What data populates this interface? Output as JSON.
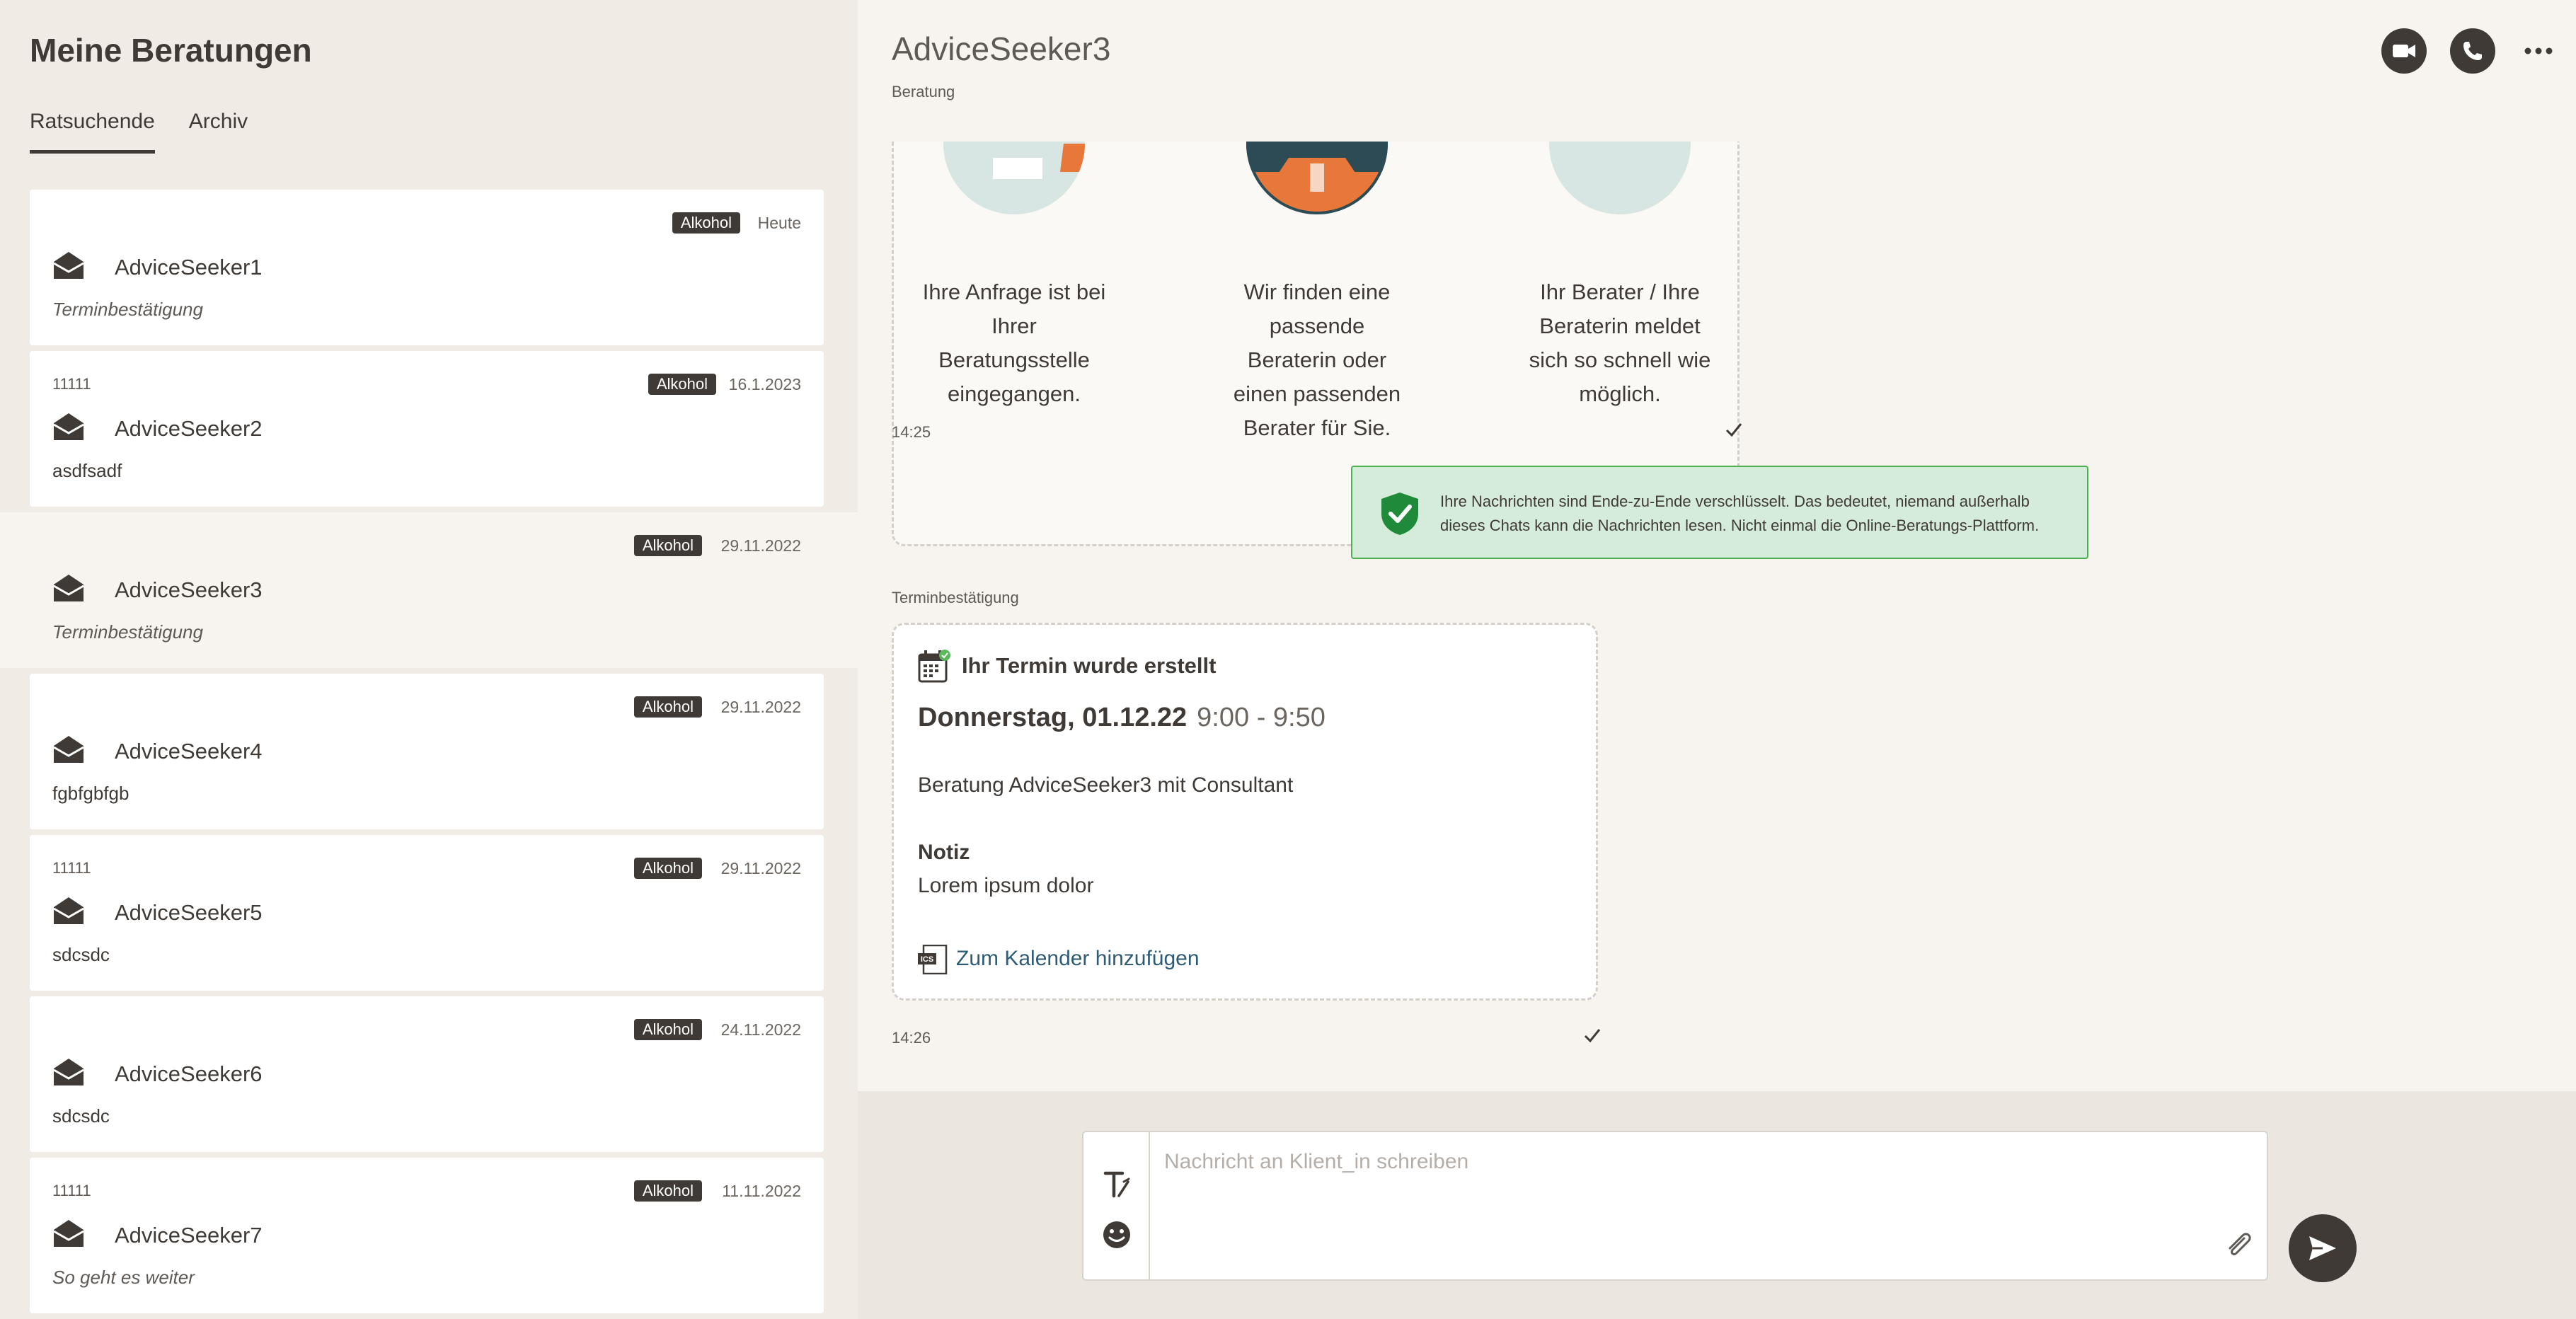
{
  "sidebar": {
    "title": "Meine Beratungen",
    "tabs": [
      {
        "label": "Ratsuchende",
        "active": true
      },
      {
        "label": "Archiv",
        "active": false
      }
    ],
    "sessions": [
      {
        "postcode": "",
        "topic": "Alkohol",
        "date": "Heute",
        "name": "AdviceSeeker1",
        "preview": "Terminbestätigung",
        "preview_italic": true,
        "selected": false
      },
      {
        "postcode": "11111",
        "topic": "Alkohol",
        "date": "16.1.2023",
        "name": "AdviceSeeker2",
        "preview": "asdfsadf",
        "preview_italic": false,
        "selected": false
      },
      {
        "postcode": "",
        "topic": "Alkohol",
        "date": "29.11.2022",
        "name": "AdviceSeeker3",
        "preview": "Terminbestätigung",
        "preview_italic": true,
        "selected": true
      },
      {
        "postcode": "",
        "topic": "Alkohol",
        "date": "29.11.2022",
        "name": "AdviceSeeker4",
        "preview": "fgbfgbfgb",
        "preview_italic": false,
        "selected": false
      },
      {
        "postcode": "11111",
        "topic": "Alkohol",
        "date": "29.11.2022",
        "name": "AdviceSeeker5",
        "preview": "sdcsdc",
        "preview_italic": false,
        "selected": false
      },
      {
        "postcode": "",
        "topic": "Alkohol",
        "date": "24.11.2022",
        "name": "AdviceSeeker6",
        "preview": "sdcsdc",
        "preview_italic": false,
        "selected": false
      },
      {
        "postcode": "11111",
        "topic": "Alkohol",
        "date": "11.11.2022",
        "name": "AdviceSeeker7",
        "preview": "So geht es weiter",
        "preview_italic": true,
        "selected": false
      }
    ]
  },
  "header": {
    "name": "AdviceSeeker3",
    "subtitle": "Beratung",
    "icons": [
      "video-call-icon",
      "phone-icon",
      "more-icon"
    ]
  },
  "welcome": {
    "steps": [
      "Ihre Anfrage ist bei Ihrer Beratungsstelle eingegangen.",
      "Wir finden eine passende Beraterin oder einen passenden Berater für Sie.",
      "Ihr Berater / Ihre Beraterin meldet sich so schnell wie möglich."
    ],
    "time": "14:25"
  },
  "e2e_notice": "Ihre Nachrichten sind Ende-zu-Ende verschlüsselt. Das bedeutet, niemand außerhalb dieses Chats kann die Nachrichten lesen. Nicht einmal die Online-Beratungs-Plattform.",
  "appointment": {
    "label": "Terminbestätigung",
    "heading": "Ihr Termin wurde erstellt",
    "date": "Donnerstag, 01.12.22",
    "time": "9:00 - 9:50",
    "title": "Beratung AdviceSeeker3 mit Consultant",
    "note_label": "Notiz",
    "note": "Lorem ipsum dolor",
    "calendar_link": "Zum Kalender hinzufügen",
    "ics_label": "ICS",
    "sent_time": "14:26"
  },
  "composer": {
    "placeholder": "Nachricht an Klient_in schreiben",
    "icons": [
      "text-format-icon",
      "emoji-icon",
      "attachment-icon",
      "send-icon"
    ]
  },
  "colors": {
    "dark": "#3f3a36",
    "sidebar_bg": "#f0ebe5",
    "main_bg": "#f7f4f0",
    "notice_bg": "#d6ecdb",
    "notice_border": "#4caf50",
    "link": "#2f5b75",
    "accent_orange": "#e8773a",
    "accent_teal": "#cfe2df"
  }
}
